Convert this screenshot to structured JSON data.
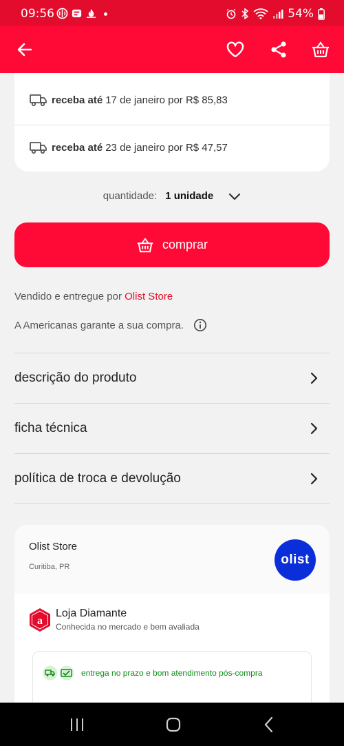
{
  "status_bar": {
    "time": "09:56",
    "battery": "54%",
    "left_icons": [
      "app-icon",
      "app-icon",
      "flame-icon",
      "dot-icon"
    ],
    "right_icons": [
      "alarm-icon",
      "bluetooth-icon",
      "wifi-icon",
      "signal-icon",
      "battery-icon"
    ]
  },
  "app_bar": {
    "icons": [
      "back-arrow-icon",
      "heart-icon",
      "share-icon",
      "basket-icon"
    ]
  },
  "shipping": {
    "options": [
      {
        "label": "receba até",
        "text": "17 de janeiro por R$ 85,83"
      },
      {
        "label": "receba até",
        "text": "23 de janeiro por R$ 47,57"
      }
    ]
  },
  "quantity": {
    "label": "quantidade:",
    "value": "1 unidade"
  },
  "buy_button": {
    "label": "comprar"
  },
  "seller": {
    "prefix": "Vendido e entregue por",
    "name": "Olist Store"
  },
  "guarantee": {
    "text": "A Americanas garante a sua compra."
  },
  "sections": [
    {
      "label": "descrição do produto"
    },
    {
      "label": "ficha técnica"
    },
    {
      "label": "política de troca e devolução"
    }
  ],
  "store_card": {
    "name": "Olist Store",
    "city": "Curitiba, PR",
    "logo_text": "olist",
    "badge_title": "Loja Diamante",
    "badge_subtitle": "Conhecida no mercado e bem avaliada",
    "badge_letter": "a",
    "perk": "entrega no prazo e bom atendimento pós-compra"
  },
  "colors": {
    "brand_red": "#ff0a36",
    "status_red": "#e30c2c",
    "olist_blue": "#0b2edb",
    "perk_green": "#138a1c"
  }
}
